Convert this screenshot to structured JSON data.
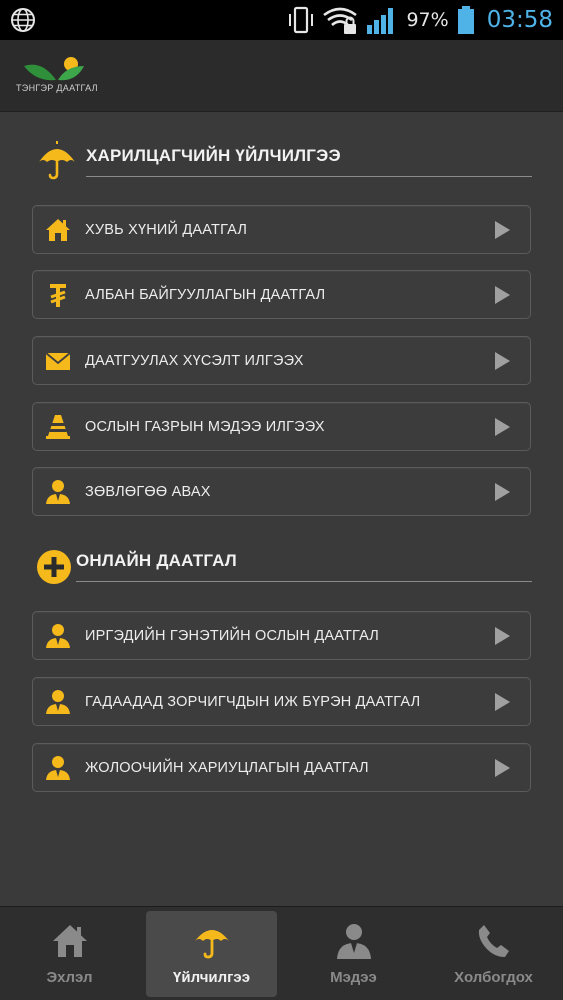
{
  "status_bar": {
    "battery_percent": "97%",
    "time": "03:58",
    "clock_color": "#4fb3e8"
  },
  "header": {
    "logo_text": "ТЭНГЭР ДААТГАЛ"
  },
  "colors": {
    "accent": "#f5b91c",
    "background": "#3a3a3a"
  },
  "sections": [
    {
      "title": "ХАРИЛЦАГЧИЙН ҮЙЛЧИЛГЭЭ",
      "icon": "umbrella-icon",
      "items": [
        {
          "label": "ХУВЬ ХҮНИЙ ДААТГАЛ",
          "icon": "house-icon"
        },
        {
          "label": "АЛБАН БАЙГУУЛЛАГЫН ДААТГАЛ",
          "icon": "tugrik-icon"
        },
        {
          "label": "ДААТГУУЛАХ ХҮСЭЛТ ИЛГЭЭХ",
          "icon": "envelope-icon"
        },
        {
          "label": "ОСЛЫН ГАЗРЫН МЭДЭЭ ИЛГЭЭХ",
          "icon": "traffic-cone-icon"
        },
        {
          "label": "ЗӨВЛӨГӨӨ АВАХ",
          "icon": "person-icon"
        }
      ]
    },
    {
      "title": "ОНЛАЙН ДААТГАЛ",
      "icon": "plus-circle-icon",
      "items": [
        {
          "label": "ИРГЭДИЙН ГЭНЭТИЙН ОСЛЫН ДААТГАЛ",
          "icon": "person-icon"
        },
        {
          "label": "ГАДААДАД ЗОРЧИГЧДЫН ИЖ БҮРЭН ДААТГАЛ",
          "icon": "person-icon"
        },
        {
          "label": "ЖОЛООЧИЙН ХАРИУЦЛАГЫН ДААТГАЛ",
          "icon": "person-icon"
        }
      ]
    }
  ],
  "bottom_nav": [
    {
      "label": "Эхлэл",
      "icon": "house-icon",
      "active": false
    },
    {
      "label": "Үйлчилгээ",
      "icon": "umbrella-icon",
      "active": true
    },
    {
      "label": "Мэдээ",
      "icon": "person-icon",
      "active": false
    },
    {
      "label": "Холбогдох",
      "icon": "phone-icon",
      "active": false
    }
  ]
}
